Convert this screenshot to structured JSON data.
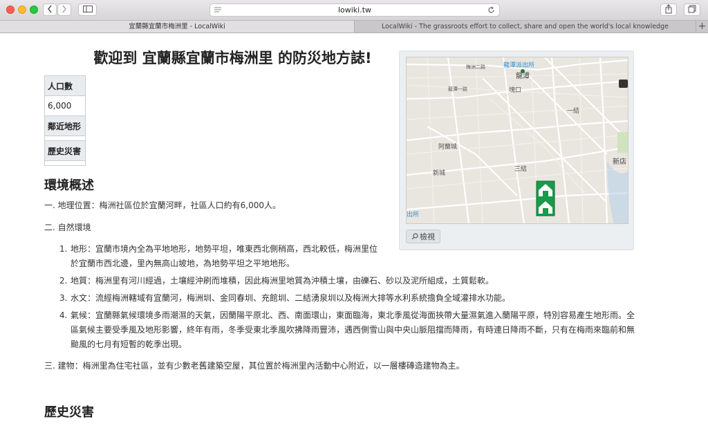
{
  "browser": {
    "url": "lowiki.tw",
    "tabs": [
      {
        "label": "宜蘭縣宜蘭市梅洲里 - LocalWiki",
        "active": true
      },
      {
        "label": "LocalWiki - The grassroots effort to collect, share and open the world's local knowledge",
        "active": false
      }
    ],
    "new_tab_label": "+"
  },
  "page": {
    "title": "歡迎到 宜蘭縣宜蘭市梅洲里 的防災地方誌!",
    "infobox": [
      {
        "label": "人口數",
        "value": "6,000"
      },
      {
        "label": "鄰近地形",
        "value": ""
      },
      {
        "label": "歷史災害",
        "value": ""
      }
    ],
    "map": {
      "labels": {
        "police": "龍潭派出所",
        "longtan": "龍潭",
        "longtan_road": "龍潭一路",
        "meizhou_road": "梅洲二路",
        "jiantou": "塊口",
        "yijie": "一結",
        "alanguo": "阿蘭城",
        "xincheng": "新城",
        "sanjie": "三結",
        "xindian": "新店",
        "chusuo": "出所"
      },
      "search_label": "檢視"
    },
    "section1": {
      "heading": "環境概述",
      "item1": "一. 地理位置：梅洲社區位於宜蘭河畔，社區人口約有6,000人。",
      "item2": "二. 自然環境",
      "subitems": [
        {
          "num": "1.",
          "text": "地形：宜蘭市境內全為平地地形，地勢平坦，唯東西北側稍高，西北較低，梅洲里位於宜蘭市西北邊，里內無高山坡地，為地勢平坦之平地地形。"
        },
        {
          "num": "2.",
          "text": "地質：梅洲里有河川經過，土壤經沖刷而堆積，因此梅洲里地質為沖積土壤，由礫石、砂以及泥所組成，土質鬆軟。"
        },
        {
          "num": "3.",
          "text": "水文：流經梅洲轄域有宜蘭河，梅洲圳、金同春圳、充館圳、二結湧泉圳以及梅洲大排等水利系統擔負全域灌排水功能。"
        },
        {
          "num": "4.",
          "text": "氣候：宜蘭縣氣候環境多雨潮濕的天氣，因蘭陽平原北、西、南面環山，東面臨海，東北季風從海面挾帶大量濕氣進入蘭陽平原，特別容易產生地形雨。全區氣候主要受季風及地形影響，終年有雨，冬季受東北季風吹拂降雨豐沛，遇西側雪山與中央山脈阻擋而降雨，有時連日降雨不斷，只有在梅雨來臨前和無颱風的七月有短暫的乾季出現。"
        }
      ],
      "item3": "三. 建物：梅洲里為住宅社區，並有少數老舊建築空屋，其位置於梅洲里內活動中心附近，以一層樓磚造建物為主。"
    },
    "section2": {
      "heading": "歷史災害"
    }
  },
  "colors": {
    "accent": "#1a9a4a",
    "map_bg": "#e8e4df",
    "poi_blue": "#2a8fd6"
  }
}
